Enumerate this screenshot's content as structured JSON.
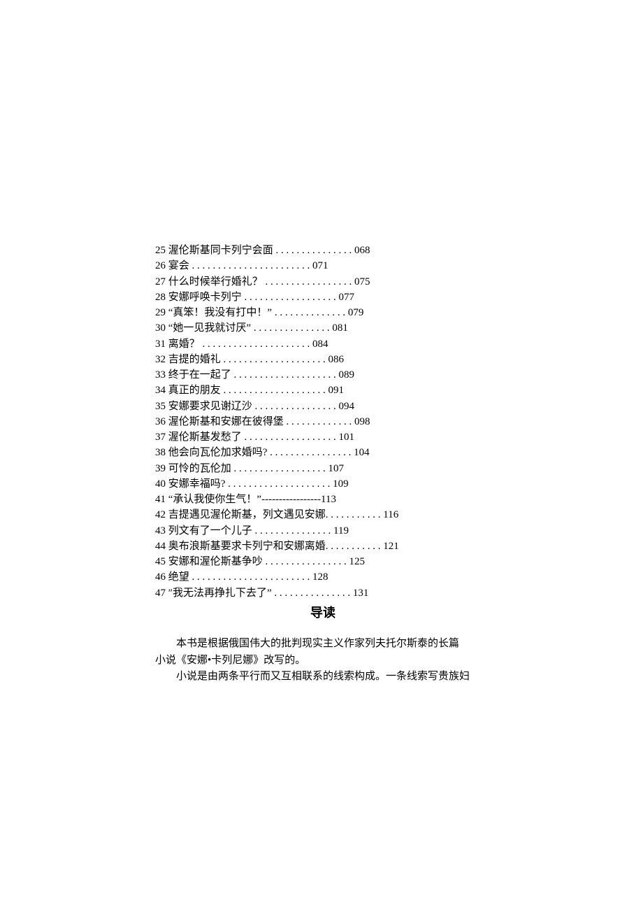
{
  "toc": [
    {
      "num": "25",
      "title": "渥伦斯基同卡列宁会面",
      "leader": " . . . . . . . . . . . . . . . ",
      "page": "068"
    },
    {
      "num": "26",
      "title": "宴会",
      "leader": " . . . . . . . . . . . . . . . . . . . . . . . ",
      "page": "071"
    },
    {
      "num": "27",
      "title": "什么时候举行婚礼？",
      "leader": " . . . . . . . . . . . . . . . . . ",
      "page": "075"
    },
    {
      "num": "28",
      "title": "安娜呼唤卡列宁",
      "leader": " . . . . . . . . . . . . . . . . . . ",
      "page": "077"
    },
    {
      "num": "29",
      "title": "“真笨！我没有打中！”",
      "leader": " . . . . . . . . . . . . . . ",
      "page": "079"
    },
    {
      "num": "30",
      "title": "“她一见我就讨厌”",
      "leader": " . . . . . . . . . . . . . . . ",
      "page": "081"
    },
    {
      "num": "31",
      "title": "离婚？",
      "leader": " . . . . . . . . . . . . . . . . . . . . . ",
      "page": "084"
    },
    {
      "num": "32",
      "title": "吉提的婚礼",
      "leader": " . . . . . . . . . . . . . . . . . . . . ",
      "page": "086"
    },
    {
      "num": "33",
      "title": "终于在一起了",
      "leader": " . . . . . . . . . . . . . . . . . . . . ",
      "page": "089"
    },
    {
      "num": "34",
      "title": "真正的朋友",
      "leader": " . . . . . . . . . . . . . . . . . . . . ",
      "page": "091"
    },
    {
      "num": "35",
      "title": "安娜要求见谢辽沙",
      "leader": " . . . . . . . . . . . . . . . . ",
      "page": "094"
    },
    {
      "num": "36",
      "title": "渥伦斯基和安娜在彼得堡",
      "leader": " . . . . . . . . . . . . . ",
      "page": "098"
    },
    {
      "num": "37",
      "title": "渥伦斯基发愁了",
      "leader": " . . . . . . . . . . . . . . . . . . ",
      "page": "101"
    },
    {
      "num": "38",
      "title": "他会向瓦伦加求婚吗?",
      "leader": " . . . . . . . . . . . . . . . . ",
      "page": "104"
    },
    {
      "num": "39",
      "title": "可怜的瓦伦加",
      "leader": " . . . . . . . . . . . . . . . . . . ",
      "page": "107"
    },
    {
      "num": "40",
      "title": "安娜幸福吗?",
      "leader": " . . . . . . . . . . . . . . . . . . . . ",
      "page": "109"
    },
    {
      "num": "41",
      "title": "“承认我使你生气！”",
      "leader": "-----------------",
      "page": "113"
    },
    {
      "num": "42",
      "title": "吉提遇见渥伦斯基，列文遇见安娜",
      "leader": ". . . . . . . . . . . ",
      "page": "116"
    },
    {
      "num": "43",
      "title": "列文有了一个儿子",
      "leader": " . . . . . . . . . . . . . . . ",
      "page": "119"
    },
    {
      "num": "44",
      "title": "奥布浪斯基要求卡列宁和安娜离婚",
      "leader": ". . . . . . . . . . . ",
      "page": "121"
    },
    {
      "num": "45",
      "title": "安娜和渥伦斯基争吵",
      "leader": " . . . . . . . . . . . . . . . . ",
      "page": "125"
    },
    {
      "num": "46",
      "title": "绝望",
      "leader": " . . . . . . . . . . . . . . . . . . . . . . . ",
      "page": "128"
    },
    {
      "num": "47",
      "title": "″我无法再挣扎下去了”",
      "leader": " . . . . . . . . . . . . . . . ",
      "page": "131"
    }
  ],
  "heading": "导读",
  "body": {
    "p1a": "本书是根据俄国伟大的批判现实主义作家列夫托尔斯泰的长篇",
    "p1b": "小说《安娜•卡列尼娜》改写的。",
    "p2a": "小说是由两条平行而又互相联系的线索构成。一条线索写贵族妇"
  }
}
